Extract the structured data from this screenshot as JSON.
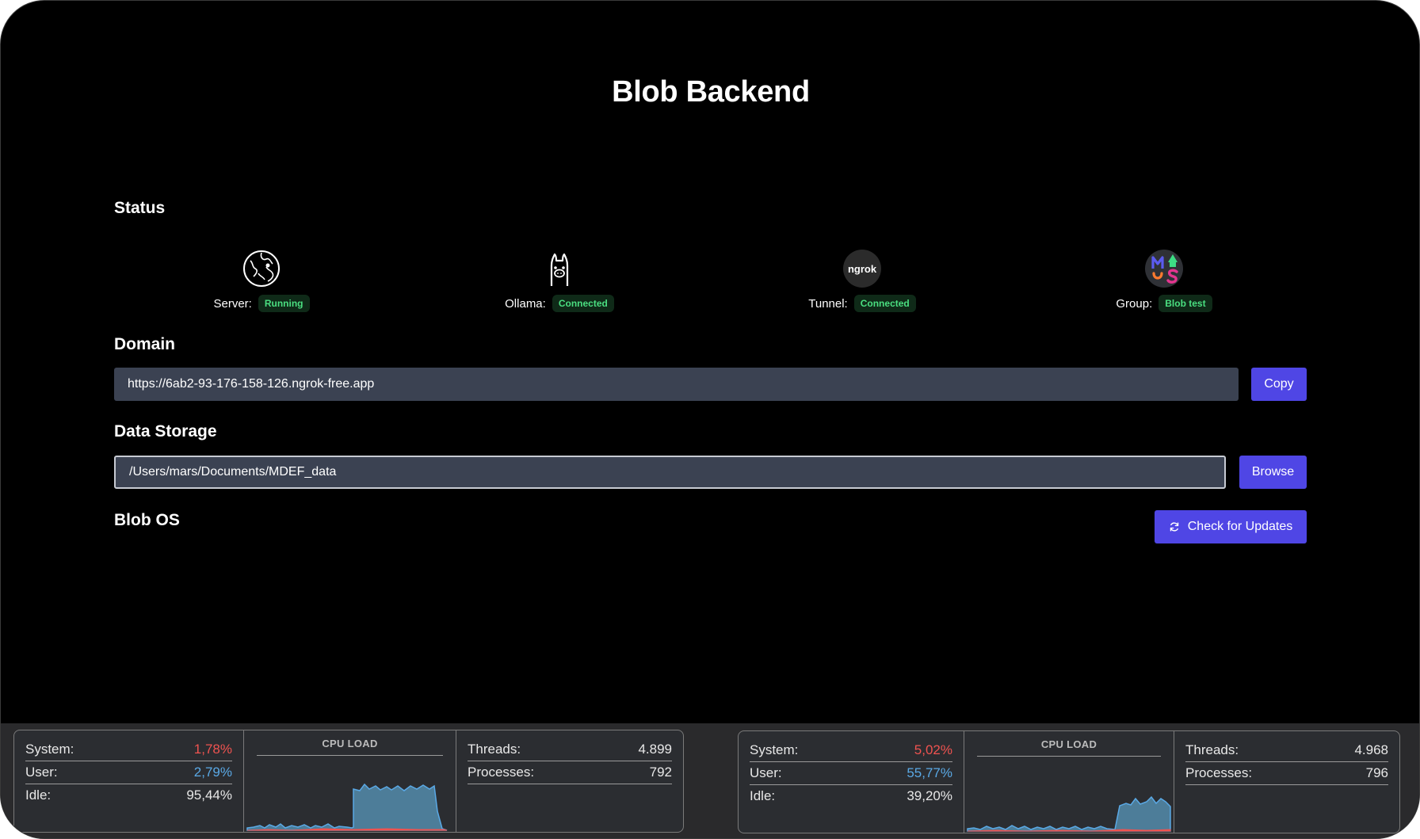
{
  "app": {
    "title": "Blob Backend"
  },
  "status": {
    "heading": "Status",
    "items": [
      {
        "label": "Server:",
        "value": "Running",
        "icon": "globe-icon"
      },
      {
        "label": "Ollama:",
        "value": "Connected",
        "icon": "llama-icon"
      },
      {
        "label": "Tunnel:",
        "value": "Connected",
        "icon": "ngrok-icon",
        "icon_text": "ngrok"
      },
      {
        "label": "Group:",
        "value": "Blob test",
        "icon": "group-logo-icon"
      }
    ]
  },
  "domain": {
    "heading": "Domain",
    "url": "https://6ab2-93-176-158-126.ngrok-free.app",
    "copy_label": "Copy"
  },
  "storage": {
    "heading": "Data Storage",
    "path": "/Users/mars/Documents/MDEF_data",
    "browse_label": "Browse"
  },
  "blob_os": {
    "heading": "Blob OS",
    "update_label": "Check for Updates"
  },
  "colors": {
    "accent": "#4f46e5",
    "badge_text": "#4ade80",
    "system_value": "#ef5350",
    "user_value": "#5aa9e6"
  },
  "monitors": [
    {
      "system_label": "System:",
      "system": "1,78%",
      "user_label": "User:",
      "user": "2,79%",
      "idle_label": "Idle:",
      "idle": "95,44%",
      "chart_title": "CPU LOAD",
      "threads_label": "Threads:",
      "threads": "4.899",
      "processes_label": "Processes:",
      "processes": "792"
    },
    {
      "system_label": "System:",
      "system": "5,02%",
      "user_label": "User:",
      "user": "55,77%",
      "idle_label": "Idle:",
      "idle": "39,20%",
      "chart_title": "CPU LOAD",
      "threads_label": "Threads:",
      "threads": "4.968",
      "processes_label": "Processes:",
      "processes": "796"
    }
  ]
}
